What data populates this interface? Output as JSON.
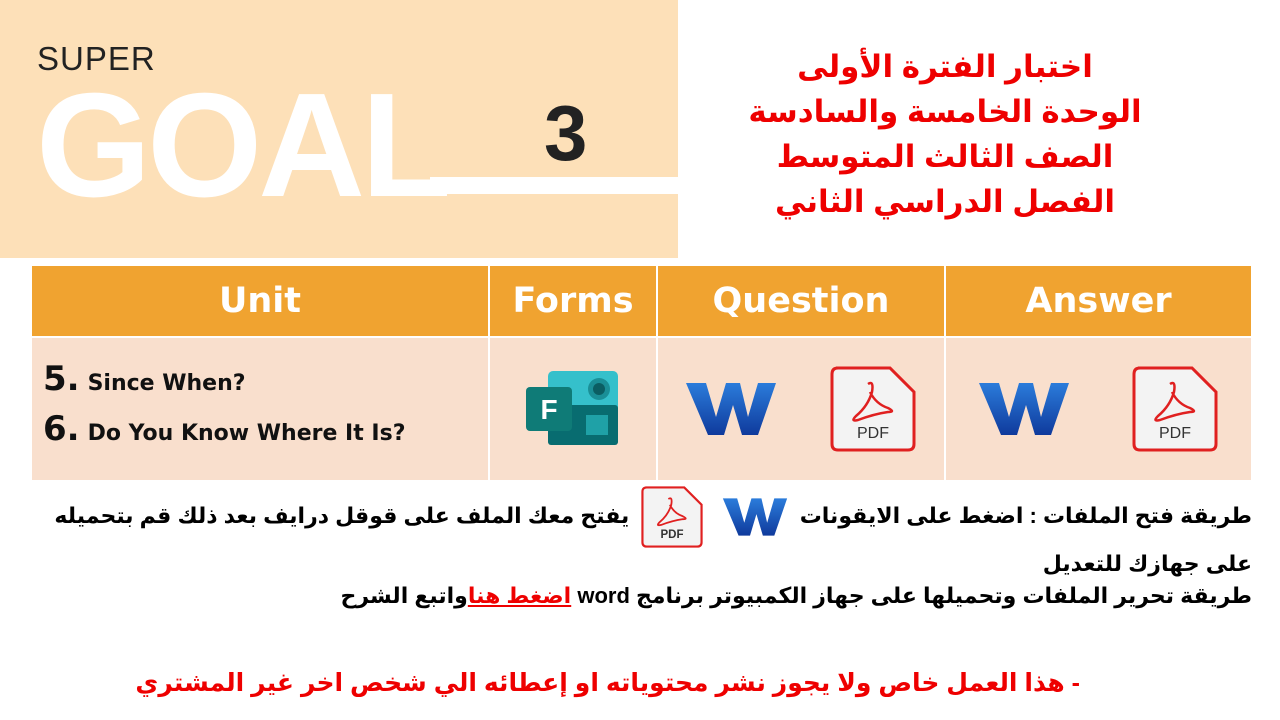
{
  "logo": {
    "super": "SUPER",
    "goal": "GOAL",
    "number": "3"
  },
  "title_lines": [
    "اختبار الفترة الأولى",
    "الوحدة الخامسة والسادسة",
    "الصف الثالث المتوسط",
    "الفصل الدراسي الثاني"
  ],
  "table": {
    "headers": [
      "Unit",
      "Forms",
      "Question",
      "Answer"
    ],
    "units": [
      {
        "num": "5.",
        "title": "Since When?"
      },
      {
        "num": "6.",
        "title": "Do You Know Where It Is?"
      }
    ],
    "forms_icon": "microsoft-forms-icon",
    "question_icons": [
      "word-icon",
      "pdf-icon"
    ],
    "answer_icons": [
      "word-icon",
      "pdf-icon"
    ],
    "pdf_label": "PDF",
    "forms_letter": "F"
  },
  "notes": {
    "line1_a": "طريقة فتح الملفات : اضغط على الايقونات",
    "line1_b": "يفتح معك الملف على قوقل درايف بعد ذلك قم بتحميله على جهازك للتعديل",
    "line2_a": "طريقة تحرير الملفات وتحميلها على جهاز الكمبيوتر برنامج",
    "line2_word": "word",
    "line2_link": "اضغط هنا",
    "line2_b": "واتبع الشرح"
  },
  "footer": "- هذا العمل خاص ولا يجوز نشر محتوياته او إعطائه الي شخص اخر غير المشتري",
  "colors": {
    "header": "#f0a330",
    "cell": "#f9dfcd",
    "red": "#ee0000",
    "logo_bg": "#fde0b8"
  }
}
